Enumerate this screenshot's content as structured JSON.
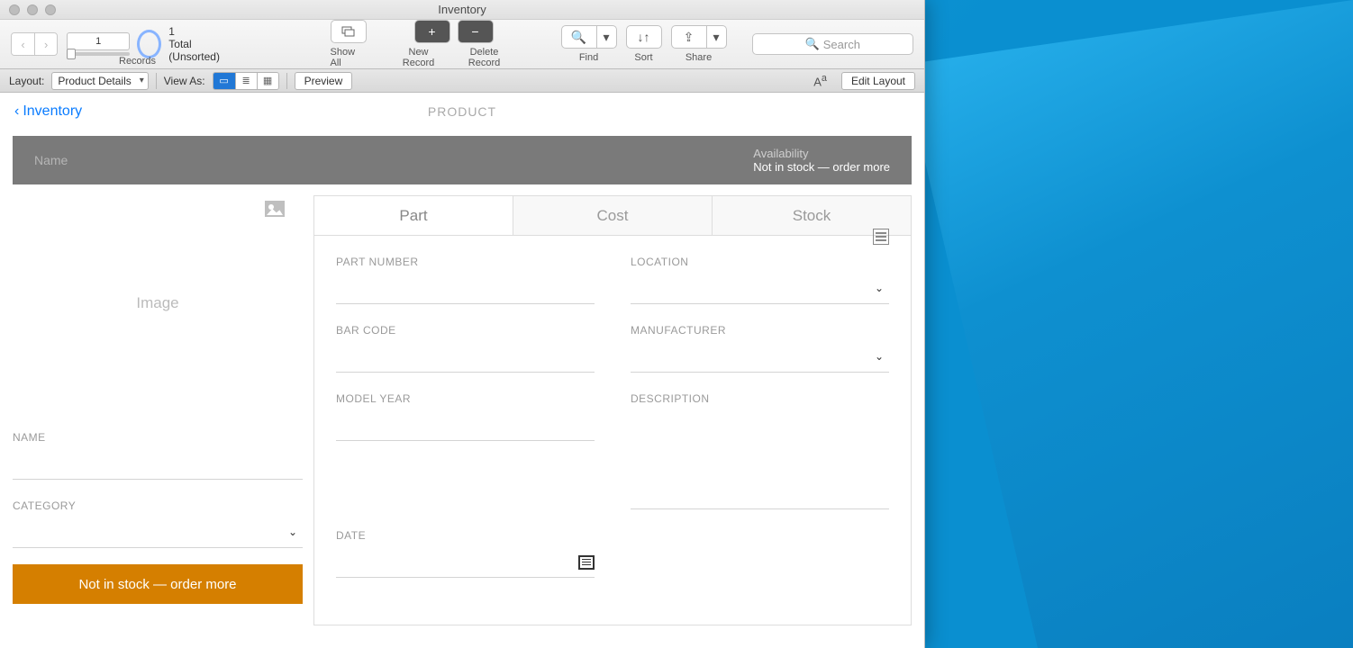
{
  "window": {
    "title": "Inventory"
  },
  "toolbar": {
    "record_number": "1",
    "total_count": "1",
    "total_label": "Total (Unsorted)",
    "records_label": "Records",
    "show_all": "Show All",
    "new_record": "New Record",
    "delete_record": "Delete Record",
    "find": "Find",
    "sort": "Sort",
    "share": "Share",
    "search_placeholder": "Search"
  },
  "layoutbar": {
    "layout_label": "Layout:",
    "layout_value": "Product Details",
    "view_as_label": "View As:",
    "preview": "Preview",
    "edit_layout": "Edit Layout"
  },
  "crumb": {
    "back": "Inventory",
    "title": "PRODUCT"
  },
  "hero": {
    "name_label": "Name",
    "availability_label": "Availability",
    "availability_value": "Not in stock — order more"
  },
  "left": {
    "image_placeholder": "Image",
    "name_label": "NAME",
    "category_label": "CATEGORY",
    "stock_status": "Not in stock — order more"
  },
  "tabs": {
    "part": "Part",
    "cost": "Cost",
    "stock": "Stock"
  },
  "fields": {
    "part_number": "PART NUMBER",
    "location": "LOCATION",
    "bar_code": "BAR CODE",
    "manufacturer": "MANUFACTURER",
    "model_year": "MODEL YEAR",
    "description": "DESCRIPTION",
    "date": "DATE"
  }
}
